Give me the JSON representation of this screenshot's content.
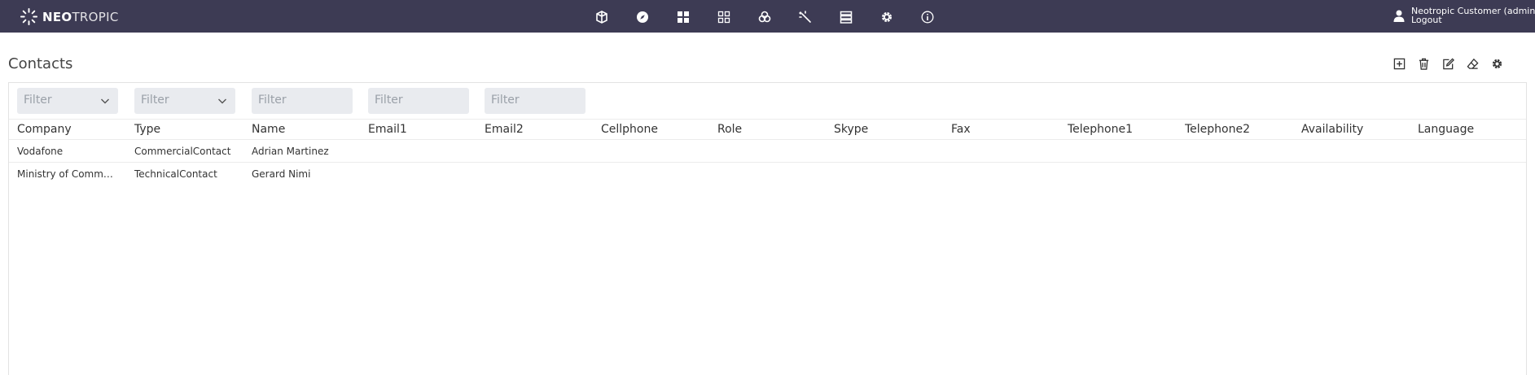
{
  "brand": {
    "name_bold": "NEO",
    "name_light": "TROPIC"
  },
  "nav": {
    "icons": [
      "box-3d-icon",
      "compass-icon",
      "dashboard-grid-icon",
      "module-grid-icon",
      "components-icon",
      "magic-wand-icon",
      "list-icon",
      "settings-icon",
      "info-icon"
    ]
  },
  "user": {
    "name": "Neotropic Customer (admin)",
    "logout": "Logout"
  },
  "page": {
    "title": "Contacts"
  },
  "toolbar": {
    "icons": [
      "add-icon",
      "delete-icon",
      "edit-icon",
      "eraser-icon",
      "settings-icon"
    ]
  },
  "filters": [
    {
      "placeholder": "Filter",
      "type": "select"
    },
    {
      "placeholder": "Filter",
      "type": "select"
    },
    {
      "placeholder": "Filter",
      "type": "text"
    },
    {
      "placeholder": "Filter",
      "type": "text"
    },
    {
      "placeholder": "Filter",
      "type": "text"
    }
  ],
  "table": {
    "columns": [
      "Company",
      "Type",
      "Name",
      "Email1",
      "Email2",
      "Cellphone",
      "Role",
      "Skype",
      "Fax",
      "Telephone1",
      "Telephone2",
      "Availability",
      "Language"
    ],
    "rows": [
      {
        "company": "Vodafone",
        "type": "CommercialContact",
        "name": "Adrian Martinez"
      },
      {
        "company": "Ministry of Communications",
        "type": "TechnicalContact",
        "name": "Gerard Nimi"
      }
    ]
  },
  "colors": {
    "topbar": "#3d3b54",
    "filter_bg": "#e9ebef"
  }
}
